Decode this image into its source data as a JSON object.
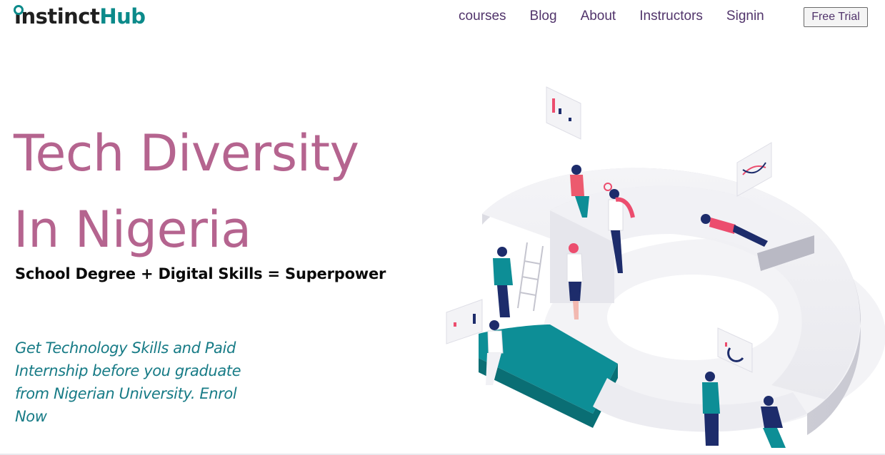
{
  "logo": {
    "prefix": "nstinct",
    "suffix": "Hub",
    "initial": "i"
  },
  "nav": {
    "links": [
      "courses",
      "Blog",
      "About",
      "Instructors",
      "Signin"
    ],
    "cta": "Free Trial"
  },
  "hero": {
    "title_line1": "Tech Diversity",
    "title_line2": "In Nigeria",
    "formula": "School Degree + Digital Skills = Superpower",
    "description": "Get Technology Skills and Paid Internship before you graduate from Nigerian University. Enrol Now"
  },
  "colors": {
    "brand_teal": "#0b8a8a",
    "title_pink": "#b5648f",
    "nav_purple": "#51346b",
    "desc_teal": "#177b86"
  },
  "illustration": {
    "description_icon": "team-climbing-chart-illustration"
  }
}
